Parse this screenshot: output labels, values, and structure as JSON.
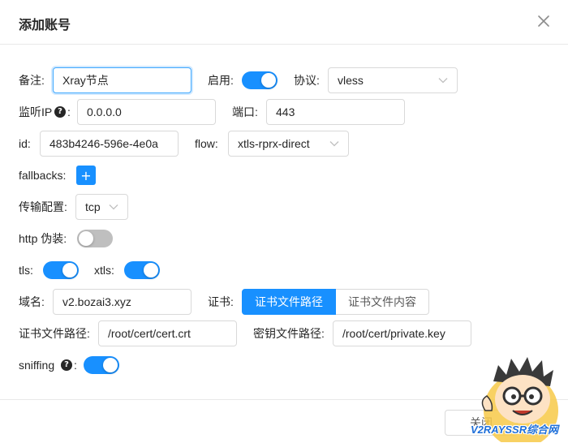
{
  "dialog": {
    "title": "添加账号",
    "close_label": "关闭"
  },
  "fields": {
    "remark": {
      "label": "备注:",
      "value": "Xray节点"
    },
    "enable": {
      "label": "启用:",
      "on": true
    },
    "protocol": {
      "label": "协议:",
      "value": "vless"
    },
    "listen_ip": {
      "label": "监听IP",
      "colon": ":",
      "value": "0.0.0.0"
    },
    "port": {
      "label": "端口:",
      "value": "443"
    },
    "id": {
      "label": "id:",
      "value": "483b4246-596e-4e0a"
    },
    "flow": {
      "label": "flow:",
      "value": "xtls-rprx-direct"
    },
    "fallbacks": {
      "label": "fallbacks:",
      "button": "+"
    },
    "transport": {
      "label": "传输配置:",
      "value": "tcp"
    },
    "http_camouflage": {
      "label": "http 伪装:",
      "on": false
    },
    "tls": {
      "label": "tls:",
      "on": true
    },
    "xtls": {
      "label": "xtls:",
      "on": true
    },
    "domain": {
      "label": "域名:",
      "value": "v2.bozai3.xyz"
    },
    "cert": {
      "label": "证书:",
      "options": [
        "证书文件路径",
        "证书文件内容"
      ],
      "selected": 0
    },
    "cert_path": {
      "label": "证书文件路径:",
      "value": "/root/cert/cert.crt"
    },
    "key_path": {
      "label": "密钥文件路径:",
      "value": "/root/cert/private.key"
    },
    "sniffing": {
      "label": "sniffing",
      "colon": ":",
      "on": true
    }
  },
  "icons": {
    "close": "close-icon",
    "help": "question-circle-icon",
    "chevron": "chevron-down-icon"
  },
  "colors": {
    "primary": "#1890ff",
    "switch_off": "#bfbfbf"
  },
  "watermark": {
    "text": "V2RAYSSR综合网"
  }
}
